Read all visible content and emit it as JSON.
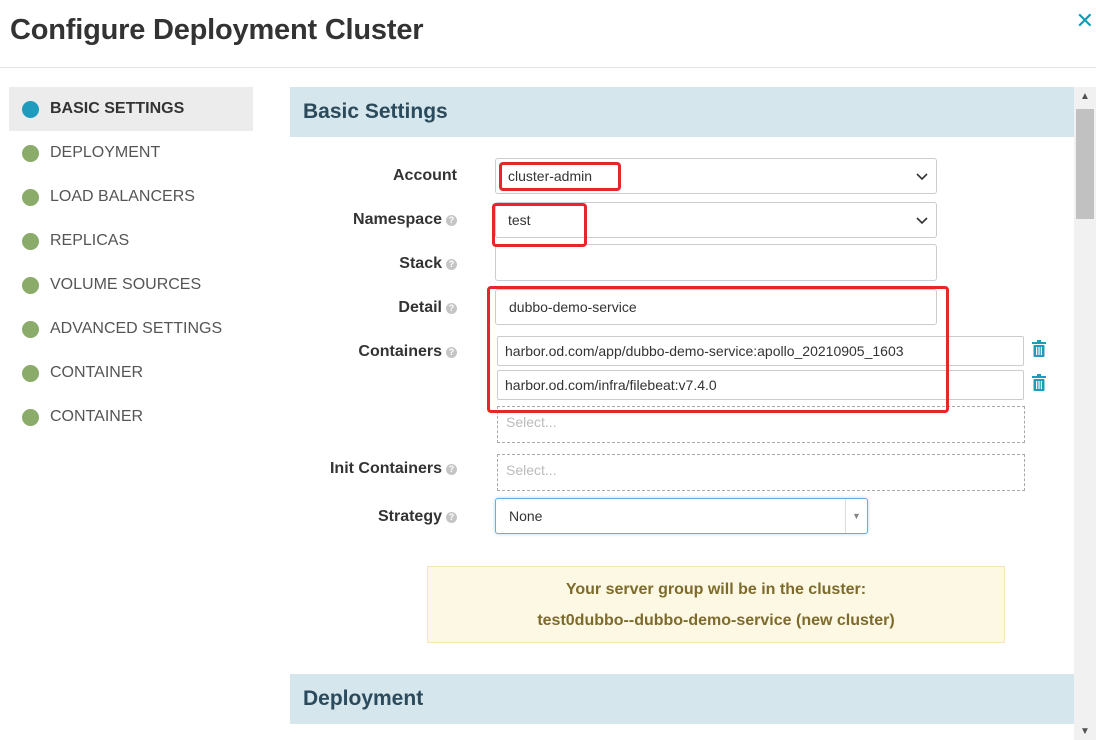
{
  "modal": {
    "title": "Configure Deployment Cluster",
    "close_icon": "close-icon"
  },
  "sidebar": {
    "items": [
      {
        "label": "BASIC SETTINGS",
        "active": true
      },
      {
        "label": "DEPLOYMENT",
        "active": false
      },
      {
        "label": "LOAD BALANCERS",
        "active": false
      },
      {
        "label": "REPLICAS",
        "active": false
      },
      {
        "label": "VOLUME SOURCES",
        "active": false
      },
      {
        "label": "ADVANCED SETTINGS",
        "active": false
      },
      {
        "label": "CONTAINER",
        "active": false
      },
      {
        "label": "CONTAINER",
        "active": false
      }
    ]
  },
  "basic_settings": {
    "header": "Basic Settings",
    "account": {
      "label": "Account",
      "value": "cluster-admin"
    },
    "namespace": {
      "label": "Namespace",
      "value": "test"
    },
    "stack": {
      "label": "Stack",
      "value": ""
    },
    "detail": {
      "label": "Detail",
      "value": "dubbo-demo-service"
    },
    "containers": {
      "label": "Containers",
      "items": [
        "harbor.od.com/app/dubbo-demo-service:apollo_20210905_1603",
        "harbor.od.com/infra/filebeat:v7.4.0"
      ],
      "placeholder": "Select..."
    },
    "init_containers": {
      "label": "Init Containers",
      "placeholder": "Select..."
    },
    "strategy": {
      "label": "Strategy",
      "value": "None"
    },
    "info": {
      "line1": "Your server group will be in the cluster:",
      "line2": "test0dubbo--dubbo-demo-service (new cluster)"
    }
  },
  "deployment": {
    "header": "Deployment"
  },
  "colors": {
    "accent": "#1e9bbd",
    "nav_dot": "#8aab6a",
    "section_header_bg": "#d5e6ec",
    "annotation": "#e6262a",
    "info_bg": "#fcf8e3"
  }
}
